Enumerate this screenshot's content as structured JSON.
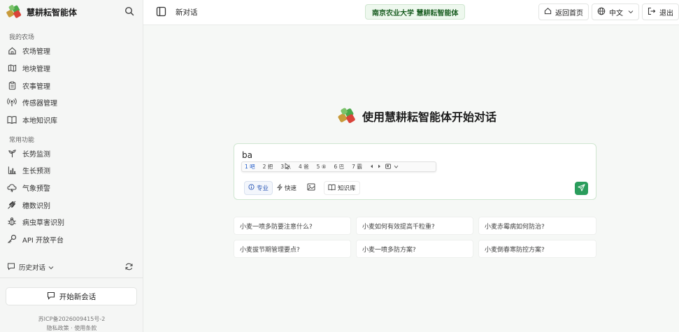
{
  "sidebar": {
    "brand_title": "慧耕耘智能体",
    "sections": [
      {
        "label": "我的农场"
      },
      {
        "label": "常用功能"
      }
    ],
    "farm_items": [
      {
        "label": "农场管理",
        "icon": "home-icon"
      },
      {
        "label": "地块管理",
        "icon": "map-icon"
      },
      {
        "label": "农事管理",
        "icon": "clipboard-icon"
      },
      {
        "label": "传感器管理",
        "icon": "sensor-icon"
      },
      {
        "label": "本地知识库",
        "icon": "book-icon"
      }
    ],
    "tool_items": [
      {
        "label": "长势监测",
        "icon": "sprout-icon"
      },
      {
        "label": "生长预测",
        "icon": "bar-chart-icon"
      },
      {
        "label": "气象预警",
        "icon": "cloud-icon"
      },
      {
        "label": "穗数识别",
        "icon": "wheat-icon"
      },
      {
        "label": "病虫草害识别",
        "icon": "bug-icon"
      },
      {
        "label": "API 开放平台",
        "icon": "key-icon"
      }
    ],
    "history_label": "历史对话",
    "new_chat_label": "开始新会话",
    "icp": "苏ICP备2026009415号-2",
    "privacy": "隐私政策",
    "separator": "·",
    "terms": "使用条款"
  },
  "topbar": {
    "new_conversation": "新对话",
    "university_badge": "南京农业大学 慧耕耘智能体",
    "home_label": "返回首页",
    "language_label": "中文",
    "logout_label": "退出"
  },
  "main": {
    "hero_title": "使用慧耕耘智能体开始对话",
    "input_text": "ba",
    "ime_candidates": [
      "1 吧",
      "2 把",
      "3 八",
      "4 爸",
      "5 ⑧",
      "6 巴",
      "7 霸"
    ],
    "options": {
      "pro": "专业",
      "fast": "快速",
      "knowledge_base": "知识库"
    },
    "suggestions": [
      "小麦一喷多防要注意什么?",
      "小麦如何有效提高千粒重?",
      "小麦赤霉病如何防治?",
      "小麦拔节期管理要点?",
      "小麦一喷多防方案?",
      "小麦倒春寒防控方案?"
    ]
  },
  "colors": {
    "accent_green": "#2a9d5c",
    "badge_bg": "#eef8ee",
    "badge_text": "#1a5e22",
    "pro_blue": "#2b57b6"
  }
}
